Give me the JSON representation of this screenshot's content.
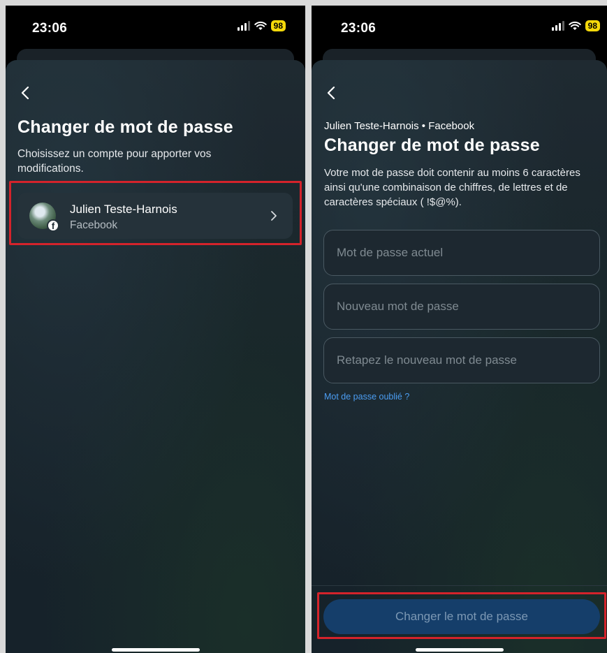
{
  "status_bar": {
    "time": "23:06",
    "battery": "98"
  },
  "left_screen": {
    "title": "Changer de mot de passe",
    "subtitle": "Choisissez un compte pour apporter vos modifications.",
    "account": {
      "name": "Julien Teste-Harnois",
      "service": "Facebook"
    }
  },
  "right_screen": {
    "context_line": "Julien Teste-Harnois • Facebook",
    "title": "Changer de mot de passe",
    "description": "Votre mot de passe doit contenir au moins 6 caractères ainsi qu'une combinaison de chiffres, de lettres et de caractères spéciaux ( !$@%).",
    "fields": {
      "current_password": {
        "placeholder": "Mot de passe actuel",
        "value": ""
      },
      "new_password": {
        "placeholder": "Nouveau mot de passe",
        "value": ""
      },
      "confirm_password": {
        "placeholder": "Retapez le nouveau mot de passe",
        "value": ""
      }
    },
    "forgot_link": "Mot de passe oublié ?",
    "submit_button": "Changer le mot de passe"
  },
  "icons": {
    "back": "chevron-left-icon",
    "chevron": "chevron-right-icon",
    "signal": "signal-icon",
    "wifi": "wifi-icon",
    "facebook_badge": "facebook-icon"
  },
  "colors": {
    "highlight": "#d4232b",
    "link": "#4b9df2",
    "primary_button": "#153e6a",
    "battery": "#f5d90a"
  }
}
